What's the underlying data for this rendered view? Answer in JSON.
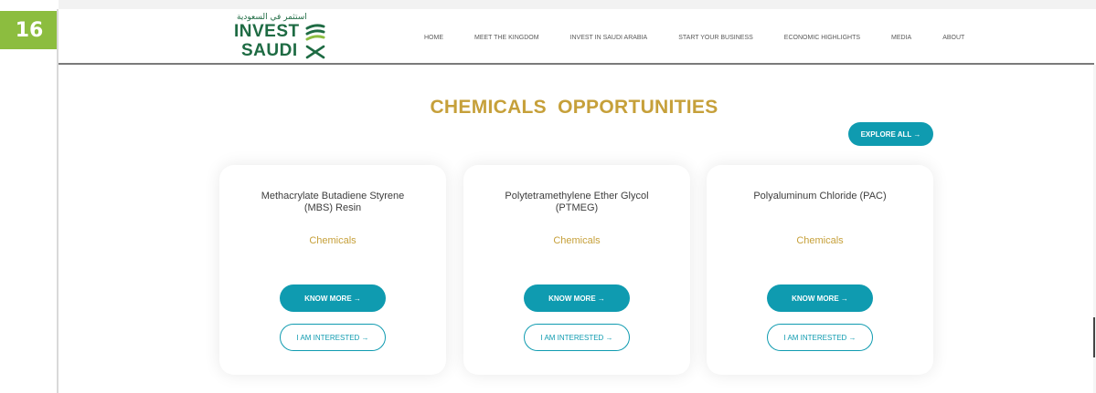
{
  "slide": {
    "number": "16"
  },
  "logo": {
    "arabic": "استثمر في السعودية",
    "invest": "INVEST",
    "saudi": "SAUDI"
  },
  "nav": {
    "items": [
      {
        "label": "HOME"
      },
      {
        "label": "MEET THE KINGDOM"
      },
      {
        "label": "INVEST IN SAUDI ARABIA"
      },
      {
        "label": "START YOUR BUSINESS"
      },
      {
        "label": "ECONOMIC HIGHLIGHTS"
      },
      {
        "label": "MEDIA"
      },
      {
        "label": "ABOUT"
      }
    ]
  },
  "section": {
    "title": "CHEMICALS OPPORTUNITIES",
    "explore_label": "EXPLORE ALL →"
  },
  "cards": [
    {
      "title_line1": "Methacrylate Butadiene Styrene",
      "title_line2": "(MBS) Resin",
      "category": "Chemicals",
      "know_more": "KNOW MORE →",
      "interested": "I AM INTERESTED →"
    },
    {
      "title_line1": "Polytetramethylene Ether Glycol",
      "title_line2": "(PTMEG)",
      "category": "Chemicals",
      "know_more": "KNOW MORE →",
      "interested": "I AM INTERESTED →"
    },
    {
      "title_line1": "Polyaluminum Chloride (PAC)",
      "title_line2": "",
      "category": "Chemicals",
      "know_more": "KNOW MORE →",
      "interested": "I AM INTERESTED →"
    }
  ],
  "colors": {
    "teal": "#0f9bb0",
    "gold": "#c6a03a",
    "brand_green": "#1e6b43",
    "badge_green": "#8cbd3f"
  },
  "icons": [
    "palm-swords-logo-icon",
    "arrow-right-icon"
  ]
}
